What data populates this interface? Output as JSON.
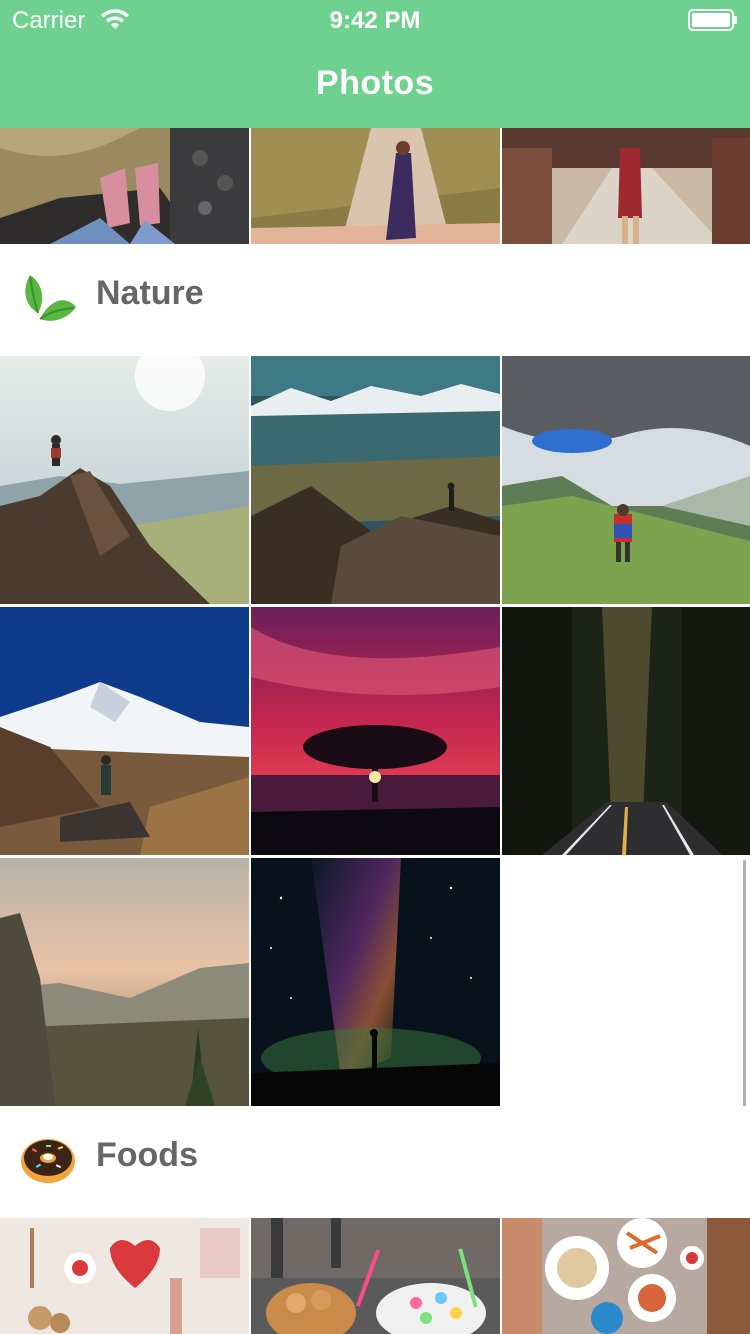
{
  "status_bar": {
    "carrier": "Carrier",
    "time": "9:42 PM"
  },
  "nav": {
    "title": "Photos"
  },
  "sections": [
    {
      "title": "Nature",
      "icon": "leaf-icon"
    },
    {
      "title": "Foods",
      "icon": "donut-icon"
    }
  ],
  "colors": {
    "header": "#6fd18f",
    "section_title": "#666666",
    "leaf": "#58b742",
    "donut_frosting": "#3b2416",
    "donut_dough": "#f3a33a"
  },
  "photos": {
    "travel_top": [
      "cockpit-feet-photo",
      "great-wall-woman-photo",
      "market-street-woman-photo"
    ],
    "nature": [
      "hiker-on-peak-photo",
      "mountain-valley-hiker-photo",
      "cloudy-valley-hiker-photo",
      "snowy-mountain-hiker-photo",
      "red-sky-tree-photo",
      "forest-road-photo",
      "cliff-sunrise-photo",
      "milky-way-photo"
    ],
    "foods_bottom": [
      "flatlay-breakfast-photo",
      "colorful-desserts-photo",
      "party-table-food-photo"
    ]
  }
}
